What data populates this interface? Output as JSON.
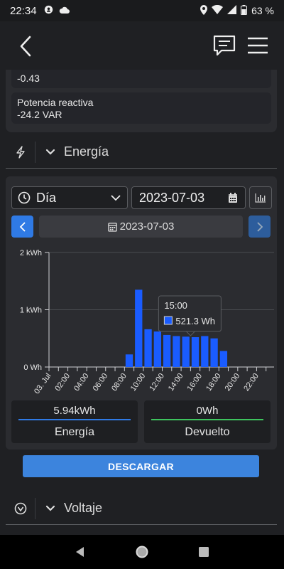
{
  "status": {
    "time": "22:34",
    "battery": "63 %"
  },
  "power": {
    "prev_value": "-0.43",
    "reactive_label": "Potencia reactiva",
    "reactive_value": "-24.2 VAR"
  },
  "sections": {
    "energy": "Energía",
    "voltage": "Voltaje"
  },
  "controls": {
    "period": "Día",
    "date_input": "2023-07-03",
    "date_display": "2023-07-03"
  },
  "chart_data": {
    "type": "bar",
    "ylabel": "",
    "ylim": [
      0,
      2
    ],
    "ytick_labels": [
      "0 Wh",
      "1 kWh",
      "2 kWh"
    ],
    "xtick_labels": [
      "03. Jul",
      "02:00",
      "04:00",
      "06:00",
      "08:00",
      "10:00",
      "12:00",
      "14:00",
      "16:00",
      "18:00",
      "20:00",
      "22:00"
    ],
    "hours": [
      0,
      1,
      2,
      3,
      4,
      5,
      6,
      7,
      8,
      9,
      10,
      11,
      12,
      13,
      14,
      15,
      16,
      17,
      18,
      19,
      20,
      21,
      22,
      23
    ],
    "values_kwh": [
      0,
      0,
      0,
      0,
      0,
      0,
      0,
      0,
      0.22,
      1.35,
      0.66,
      0.62,
      0.56,
      0.54,
      0.53,
      0.5213,
      0.54,
      0.5,
      0.28,
      0,
      0,
      0,
      0,
      0
    ],
    "bar_color": "#1a5cff",
    "grid": true,
    "tooltip": {
      "title": "15:00",
      "value": "521.3 Wh"
    }
  },
  "stats": {
    "energy_value": "5.94kWh",
    "energy_label": "Energía",
    "energy_color": "#2f7ae5",
    "returned_value": "0Wh",
    "returned_label": "Devuelto",
    "returned_color": "#3ec45e"
  },
  "download_label": "DESCARGAR"
}
